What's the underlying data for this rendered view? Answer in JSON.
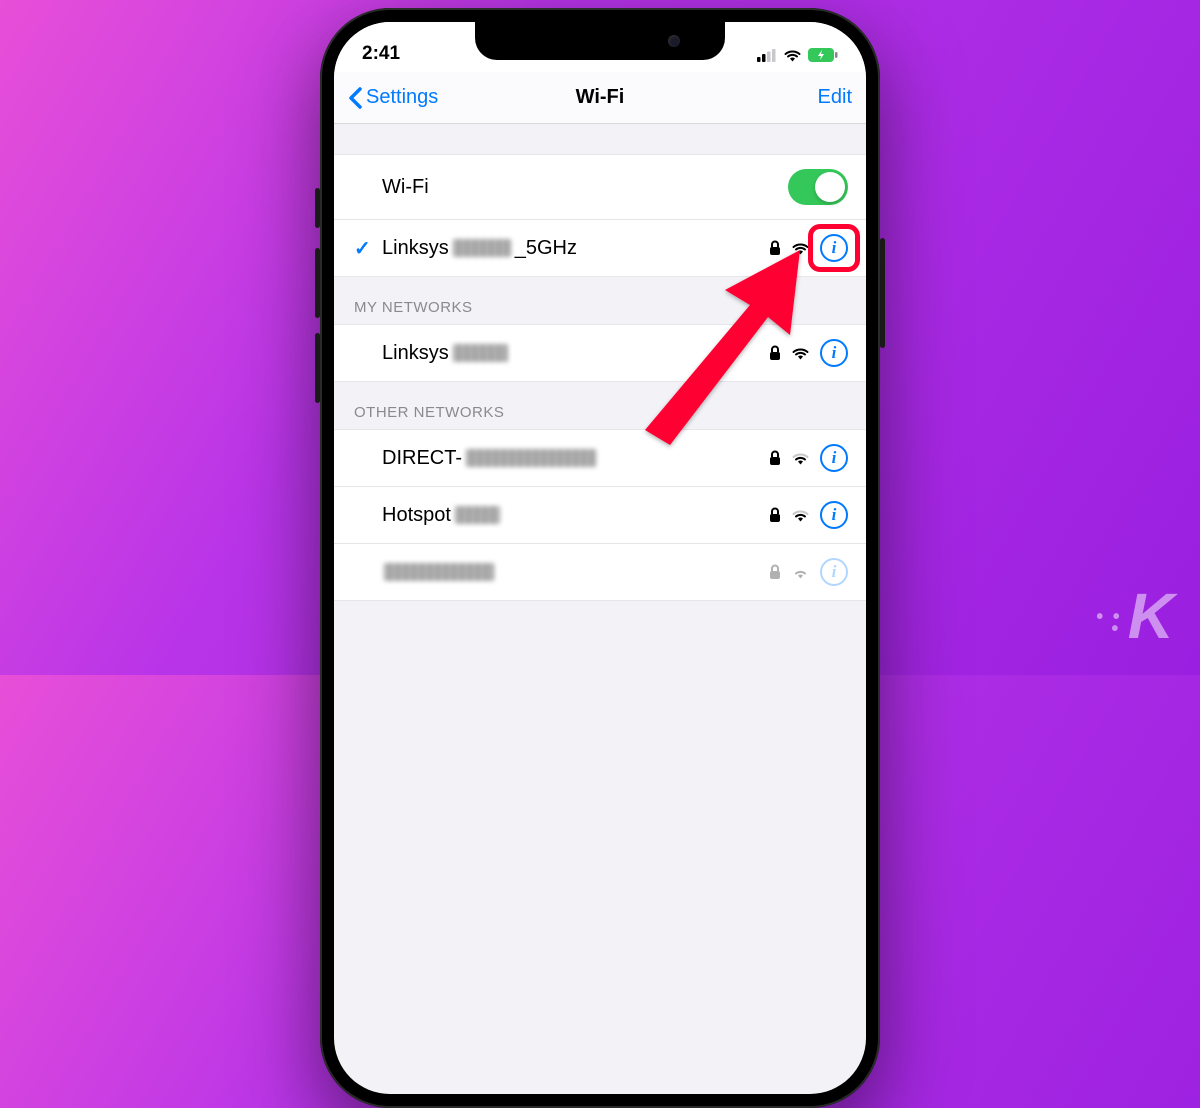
{
  "status": {
    "time": "2:41"
  },
  "nav": {
    "back": "Settings",
    "title": "Wi-Fi",
    "edit": "Edit"
  },
  "wifi": {
    "toggle_label": "Wi-Fi",
    "connected": {
      "name_prefix": "Linksys",
      "name_suffix": "_5GHz",
      "secured": true
    }
  },
  "sections": {
    "my": {
      "header": "MY NETWORKS",
      "items": [
        {
          "name_prefix": "Linksys",
          "secured": true
        }
      ]
    },
    "other": {
      "header": "OTHER NETWORKS",
      "items": [
        {
          "name_prefix": "DIRECT-",
          "secured": true
        },
        {
          "name_prefix": "Hotspot",
          "secured": true
        }
      ]
    }
  },
  "colors": {
    "accent": "#007aff",
    "toggle_on": "#34c759",
    "highlight": "#ff0030"
  }
}
